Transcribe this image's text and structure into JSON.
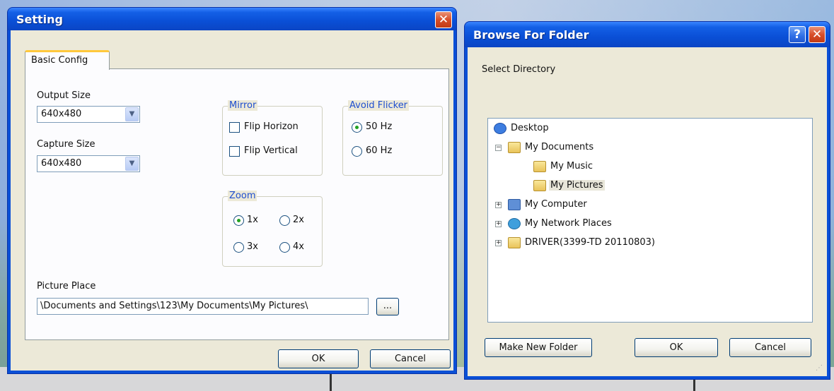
{
  "setting_dialog": {
    "title": "Setting",
    "close_glyph": "✕",
    "tab_label": "Basic Config",
    "output_size": {
      "label": "Output Size",
      "value": "640x480"
    },
    "capture_size": {
      "label": "Capture Size",
      "value": "640x480"
    },
    "mirror": {
      "title": "Mirror",
      "flip_horizon": "Flip Horizon",
      "flip_vertical": "Flip Vertical",
      "flip_horizon_checked": false,
      "flip_vertical_checked": false
    },
    "avoid_flicker": {
      "title": "Avoid Flicker",
      "options": [
        "50 Hz",
        "60 Hz"
      ],
      "selected": "50 Hz"
    },
    "zoom": {
      "title": "Zoom",
      "options": [
        "1x",
        "2x",
        "3x",
        "4x"
      ],
      "selected": "1x"
    },
    "picture_place": {
      "label": "Picture Place",
      "value": "\\Documents and Settings\\123\\My Documents\\My Pictures\\",
      "browse_label": "..."
    },
    "ok_label": "OK",
    "cancel_label": "Cancel"
  },
  "browse_dialog": {
    "title": "Browse For Folder",
    "help_glyph": "?",
    "close_glyph": "✕",
    "prompt": "Select Directory",
    "tree": [
      {
        "label": "Desktop",
        "icon": "desktop-icon"
      },
      {
        "label": "My Documents",
        "icon": "my-documents-folder-icon",
        "expander": "⊟"
      },
      {
        "label": "My Music",
        "icon": "music-folder-icon"
      },
      {
        "label": "My Pictures",
        "icon": "pictures-folder-icon",
        "selected": true
      },
      {
        "label": "My Computer",
        "icon": "computer-icon",
        "expander": "⊞"
      },
      {
        "label": "My Network Places",
        "icon": "network-places-icon",
        "expander": "⊞"
      },
      {
        "label": "DRIVER(3399-TD 20110803)",
        "icon": "folder-icon",
        "expander": "⊞"
      }
    ],
    "make_new_folder_label": "Make New Folder",
    "ok_label": "OK",
    "cancel_label": "Cancel"
  },
  "colors": {
    "xp_title_blue": "#0a4fd6",
    "dialog_face": "#ece9d8",
    "close_red": "#d84f2a",
    "radio_green": "#21a121",
    "group_title_blue": "#1f4fcf"
  }
}
